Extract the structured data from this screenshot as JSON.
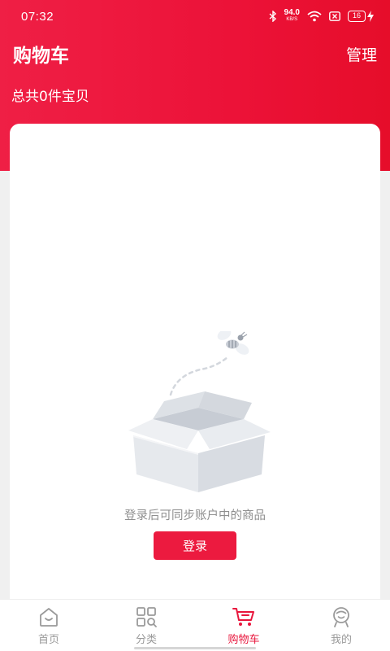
{
  "status_bar": {
    "time": "07:32",
    "net_speed_value": "94.0",
    "net_speed_unit": "KB/S",
    "battery": "16",
    "icons": [
      "bluetooth-icon",
      "wifi-icon",
      "sim-off-icon",
      "battery-icon",
      "charging-icon"
    ]
  },
  "header": {
    "title": "购物车",
    "manage_label": "管理",
    "item_count_text": "总共0件宝贝"
  },
  "empty_state": {
    "message": "登录后可同步账户中的商品",
    "login_label": "登录",
    "illustration": "open-box-with-bee"
  },
  "bottom_nav": {
    "items": [
      {
        "label": "首页",
        "icon": "home-icon",
        "active": false
      },
      {
        "label": "分类",
        "icon": "category-icon",
        "active": false
      },
      {
        "label": "购物车",
        "icon": "cart-icon",
        "active": true
      },
      {
        "label": "我的",
        "icon": "profile-icon",
        "active": false
      }
    ]
  },
  "colors": {
    "brand_red": "#ec1a3f",
    "inactive_gray": "#9a9a9a",
    "background": "#f0f0f0"
  }
}
